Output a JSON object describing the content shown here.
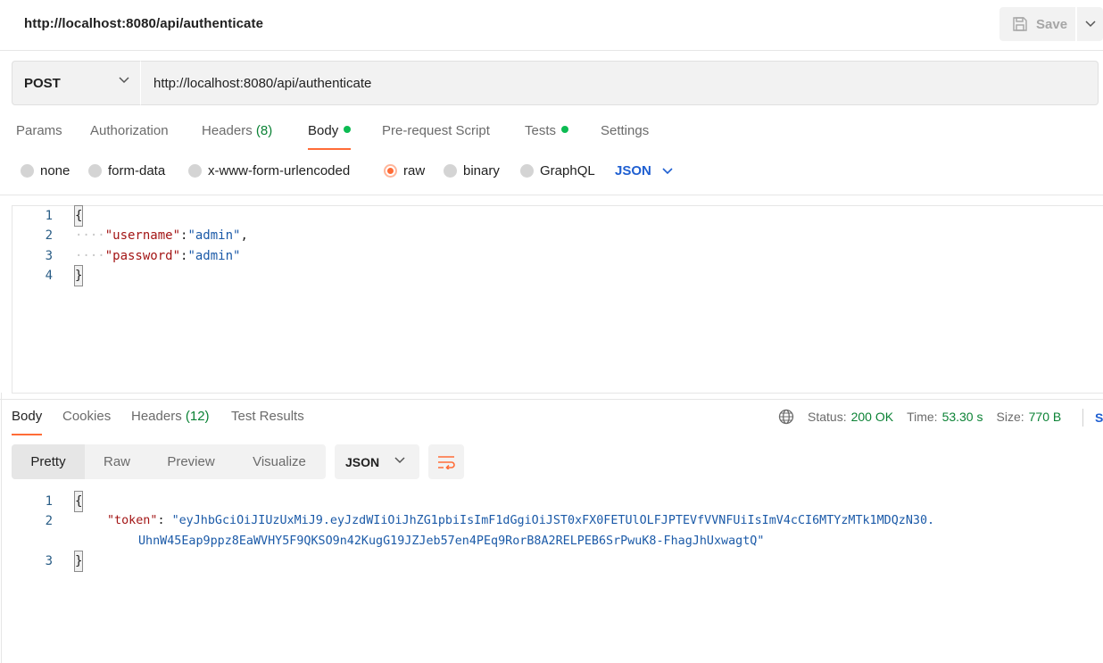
{
  "request": {
    "title": "http://localhost:8080/api/authenticate",
    "method": "POST",
    "url": "http://localhost:8080/api/authenticate",
    "save_label": "Save"
  },
  "request_tabs": {
    "params": "Params",
    "authorization": "Authorization",
    "headers": "Headers",
    "headers_count": "(8)",
    "body": "Body",
    "prerequest": "Pre-request Script",
    "tests": "Tests",
    "settings": "Settings"
  },
  "body_types": {
    "none": "none",
    "form_data": "form-data",
    "urlencoded": "x-www-form-urlencoded",
    "raw": "raw",
    "binary": "binary",
    "graphql": "GraphQL",
    "language": "JSON",
    "selected": "raw"
  },
  "request_body": {
    "line_numbers": [
      "1",
      "2",
      "3",
      "4"
    ],
    "open_brace": "{",
    "close_brace": "}",
    "indent": "····",
    "key1": "\"username\"",
    "val1": "\"admin\"",
    "key2": "\"password\"",
    "val2": "\"admin\"",
    "colon": ":",
    "comma": ","
  },
  "response_tabs": {
    "body": "Body",
    "cookies": "Cookies",
    "headers": "Headers",
    "headers_count": "(12)",
    "test_results": "Test Results"
  },
  "response_status": {
    "status_label": "Status:",
    "status_value": "200 OK",
    "time_label": "Time:",
    "time_value": "53.30 s",
    "size_label": "Size:",
    "size_value": "770 B",
    "more": "S"
  },
  "response_view": {
    "pretty": "Pretty",
    "raw": "Raw",
    "preview": "Preview",
    "visualize": "Visualize",
    "format": "JSON"
  },
  "response_body": {
    "line_numbers": [
      "1",
      "2",
      "3"
    ],
    "open_brace": "{",
    "close_brace": "}",
    "key": "\"token\"",
    "colon": ": ",
    "token_line1": "\"eyJhbGciOiJIUzUxMiJ9.eyJzdWIiOiJhZG1pbiIsImF1dGgiOiJST0xFX0FETUlOLFJPTEVfVVNFUiIsImV4cCI6MTYzMTk1MDQzN30.",
    "token_line2": "UhnW45Eap9ppz8EaWVHY5F9QKSO9n42KugG19JZJeb57en4PEq9RorB8A2RELPEB6SrPwuK8-FhagJhUxwagtQ\""
  },
  "colors": {
    "accent": "#ff6c37",
    "success": "#0b8235",
    "link": "#1f5fd1"
  }
}
